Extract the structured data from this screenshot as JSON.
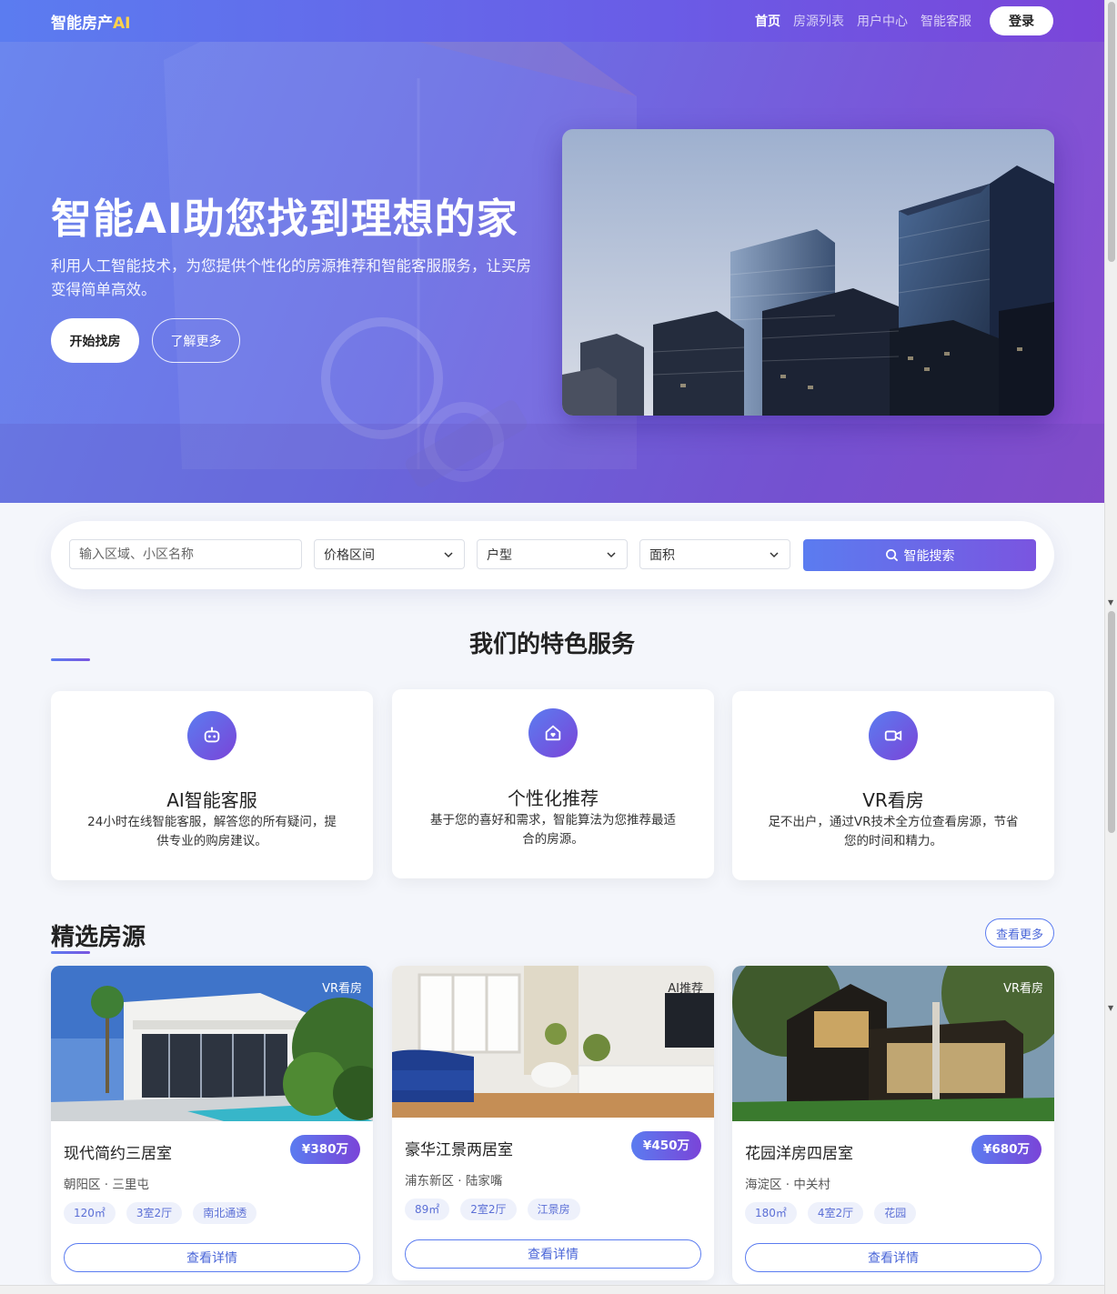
{
  "nav": {
    "logo_text": "智能房产",
    "logo_accent": "AI",
    "links": [
      "首页",
      "房源列表",
      "用户中心",
      "智能客服"
    ],
    "login": "登录"
  },
  "hero": {
    "title": "智能AI助您找到理想的家",
    "subtitle": "利用人工智能技术，为您提供个性化的房源推荐和智能客服服务，让买房变得简单高效。",
    "primary_btn": "开始找房",
    "secondary_btn": "了解更多"
  },
  "search": {
    "placeholder": "输入区域、小区名称",
    "price": "价格区间",
    "layout": "户型",
    "area": "面积",
    "button": "智能搜索"
  },
  "services": {
    "title": "我们的特色服务",
    "items": [
      {
        "icon": "robot-icon",
        "title": "AI智能客服",
        "desc": "24小时在线智能客服，解答您的所有疑问，提供专业的购房建议。"
      },
      {
        "icon": "home-heart-icon",
        "title": "个性化推荐",
        "desc": "基于您的喜好和需求，智能算法为您推荐最适合的房源。"
      },
      {
        "icon": "video-icon",
        "title": "VR看房",
        "desc": "足不出户，通过VR技术全方位查看房源，节省您的时间和精力。"
      }
    ]
  },
  "listings": {
    "title": "精选房源",
    "more": "查看更多",
    "items": [
      {
        "badge": "VR看房",
        "name": "现代简约三居室",
        "price": "¥380万",
        "location": "朝阳区 · 三里屯",
        "tags": [
          "120㎡",
          "3室2厅",
          "南北通透"
        ],
        "button": "查看详情"
      },
      {
        "badge": "AI推荐",
        "name": "豪华江景两居室",
        "price": "¥450万",
        "location": "浦东新区 · 陆家嘴",
        "tags": [
          "89㎡",
          "2室2厅",
          "江景房"
        ],
        "button": "查看详情"
      },
      {
        "badge": "VR看房",
        "name": "花园洋房四居室",
        "price": "¥680万",
        "location": "海淀区 · 中关村",
        "tags": [
          "180㎡",
          "4室2厅",
          "花园"
        ],
        "button": "查看详情"
      }
    ]
  },
  "colors": {
    "accent_start": "#5b7cf0",
    "accent_end": "#7a44d8",
    "logo_accent": "#ffd24a"
  }
}
